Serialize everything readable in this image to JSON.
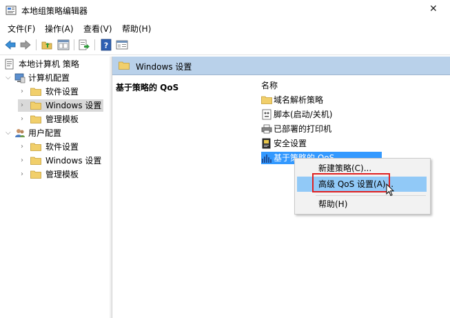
{
  "window": {
    "title": "本地组策略编辑器",
    "close_glyph": "✕"
  },
  "menubar": {
    "items": [
      "文件(F)",
      "操作(A)",
      "查看(V)",
      "帮助(H)"
    ]
  },
  "tree": {
    "root": "本地计算机 策略",
    "computer_config": "计算机配置",
    "computer_children": [
      "软件设置",
      "Windows 设置",
      "管理模板"
    ],
    "user_config": "用户配置",
    "user_children": [
      "软件设置",
      "Windows 设置",
      "管理模板"
    ]
  },
  "right_pane": {
    "header": "Windows 设置",
    "description_title": "基于策略的 QoS",
    "column_name": "名称",
    "items": [
      "域名解析策略",
      "脚本(启动/关机)",
      "已部署的打印机",
      "安全设置",
      "基于策略的 QoS"
    ]
  },
  "context_menu": {
    "items": [
      "新建策略(C)...",
      "高级 QoS 设置(A)...",
      "帮助(H)"
    ]
  },
  "colors": {
    "header_bg": "#b9d1ea",
    "selection": "#3399ff",
    "menu_highlight": "#91c9f7",
    "annotation_box": "#e02020"
  }
}
